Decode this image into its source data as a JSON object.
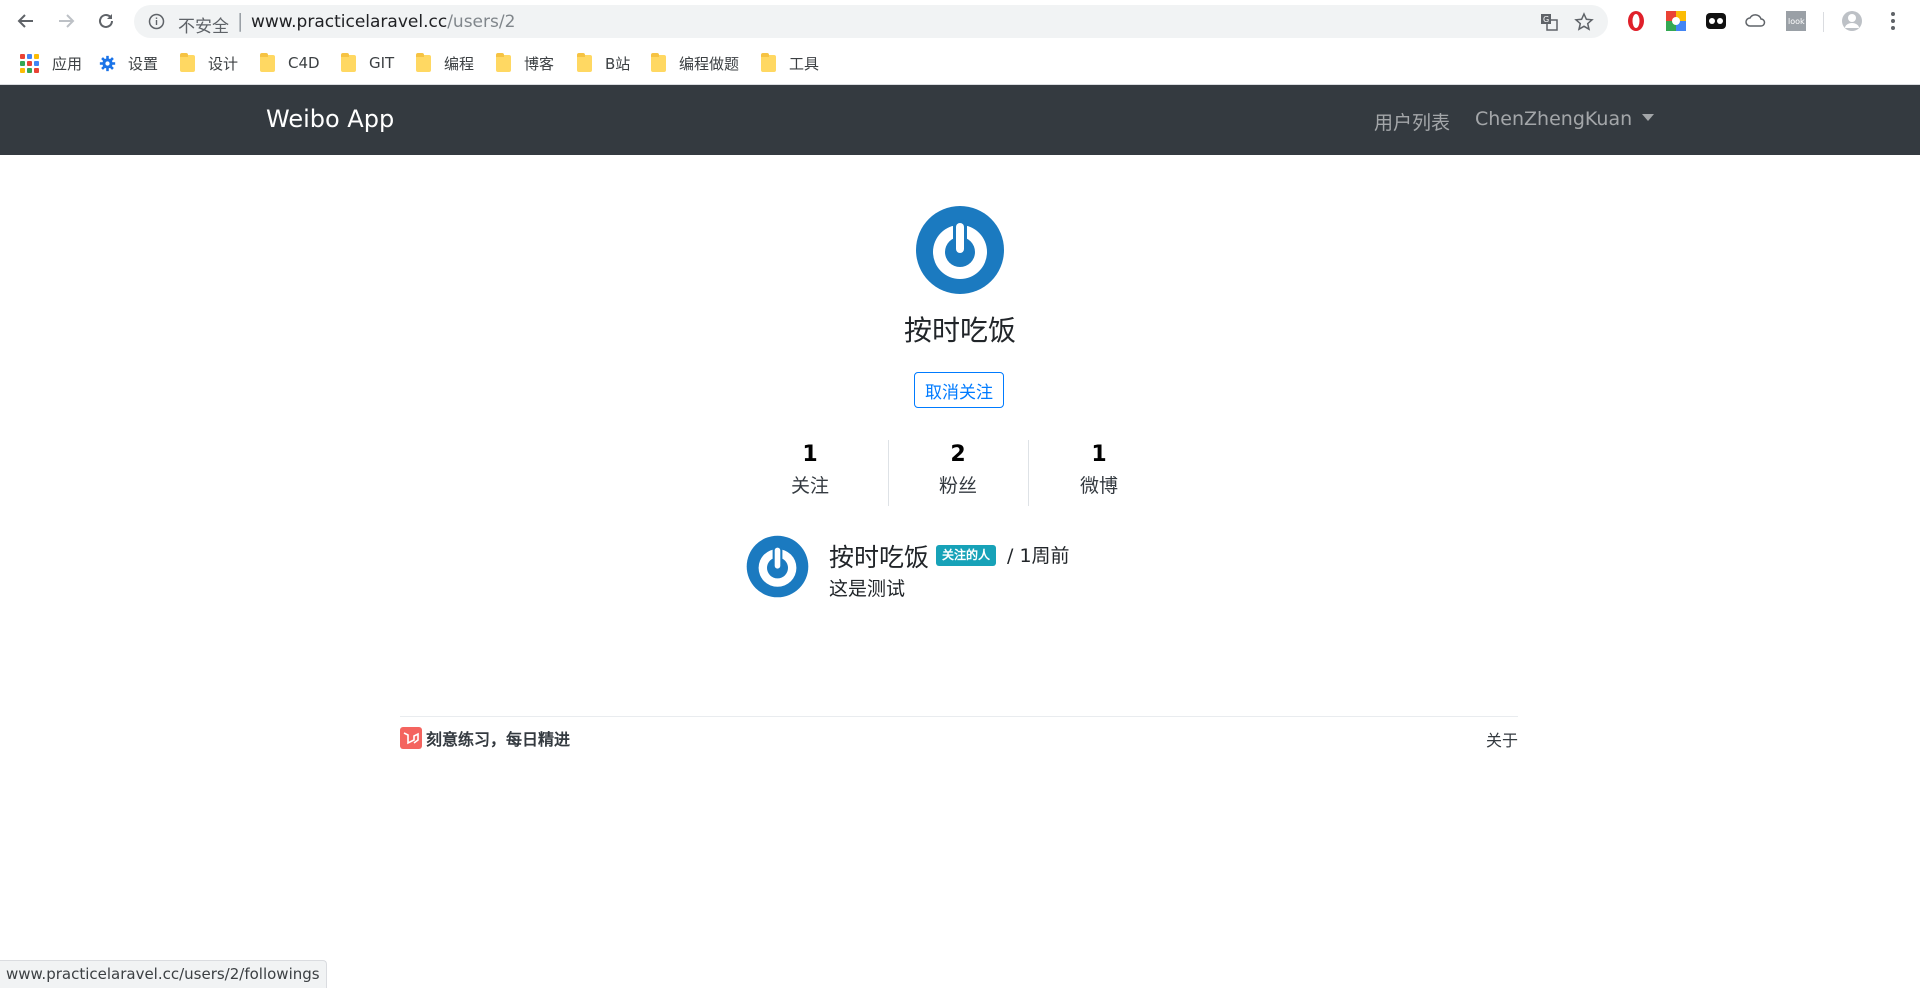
{
  "browser": {
    "insecure_label": "不安全",
    "url_host": "www.practicelaravel.cc",
    "url_path": "/users/2",
    "status_url": "www.practicelaravel.cc/users/2/followings"
  },
  "bookmarks": [
    {
      "label": "应用",
      "icon": "apps-grid-icon"
    },
    {
      "label": "设置",
      "icon": "gear-icon"
    },
    {
      "label": "设计",
      "icon": "folder-icon"
    },
    {
      "label": "C4D",
      "icon": "folder-icon"
    },
    {
      "label": "GIT",
      "icon": "folder-icon"
    },
    {
      "label": "编程",
      "icon": "folder-icon"
    },
    {
      "label": "博客",
      "icon": "folder-icon"
    },
    {
      "label": "B站",
      "icon": "folder-icon"
    },
    {
      "label": "编程做题",
      "icon": "folder-icon"
    },
    {
      "label": "工具",
      "icon": "folder-icon"
    }
  ],
  "navbar": {
    "brand": "Weibo App",
    "users_link": "用户列表",
    "current_user": "ChenZhengKuan"
  },
  "profile": {
    "name": "按时吃饭",
    "unfollow_label": "取消关注",
    "stats": [
      {
        "value": "1",
        "label": "关注"
      },
      {
        "value": "2",
        "label": "粉丝"
      },
      {
        "value": "1",
        "label": "微博"
      }
    ]
  },
  "status": {
    "author": "按时吃饭",
    "badge": "关注的人",
    "time": "/ 1周前",
    "content": "这是测试"
  },
  "footer": {
    "slogan": "刻意练习，每日精进",
    "about": "关于"
  },
  "colors": {
    "navbar_bg": "#343a40",
    "accent_blue": "#007bff",
    "badge_teal": "#17a2b8",
    "avatar_blue": "#1b7ac0"
  }
}
